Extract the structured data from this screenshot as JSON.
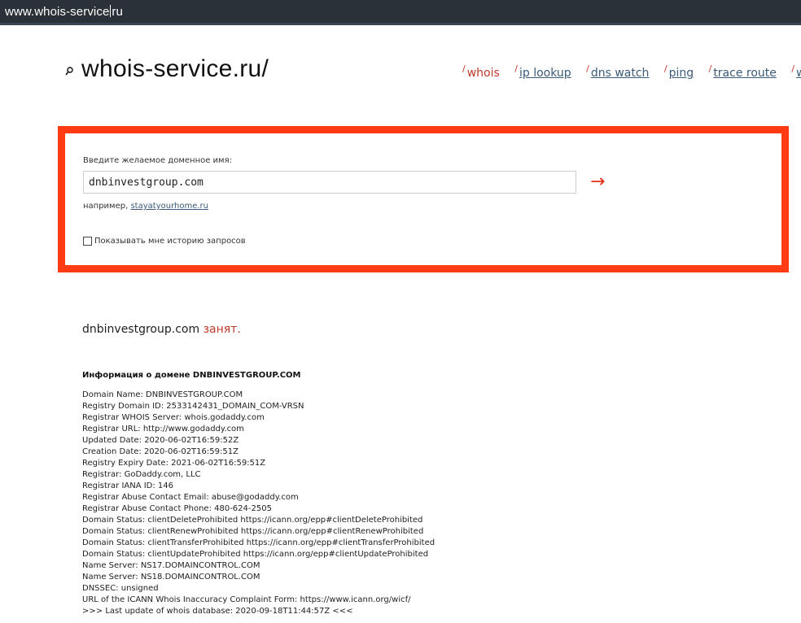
{
  "browser": {
    "url_before_caret": "www.whois-service",
    "url_after_caret": "ru"
  },
  "header": {
    "logo_text": "whois-service.ru/",
    "nav": [
      {
        "label": "whois",
        "active": true
      },
      {
        "label": "ip lookup",
        "active": false
      },
      {
        "label": "dns watch",
        "active": false
      },
      {
        "label": "ping",
        "active": false
      },
      {
        "label": "trace route",
        "active": false
      },
      {
        "label": "wh",
        "active": false
      }
    ]
  },
  "search": {
    "label": "Введите желаемое доменное имя:",
    "value": "dnbinvestgroup.com",
    "go_arrow": "→",
    "example_prefix": "например,",
    "example_link": "stayatyourhome.ru",
    "history_label": "Показывать мне историю запросов",
    "history_checked": false
  },
  "result": {
    "domain": "dnbinvestgroup.com",
    "status": "занят."
  },
  "info": {
    "title": "Информация о домене DNBINVESTGROUP.COM",
    "lines": [
      "Domain Name: DNBINVESTGROUP.COM",
      "Registry Domain ID: 2533142431_DOMAIN_COM-VRSN",
      "Registrar WHOIS Server: whois.godaddy.com",
      "Registrar URL: http://www.godaddy.com",
      "Updated Date: 2020-06-02T16:59:52Z",
      "Creation Date: 2020-06-02T16:59:51Z",
      "Registry Expiry Date: 2021-06-02T16:59:51Z",
      "Registrar: GoDaddy.com, LLC",
      "Registrar IANA ID: 146",
      "Registrar Abuse Contact Email: abuse@godaddy.com",
      "Registrar Abuse Contact Phone: 480-624-2505",
      "Domain Status: clientDeleteProhibited https://icann.org/epp#clientDeleteProhibited",
      "Domain Status: clientRenewProhibited https://icann.org/epp#clientRenewProhibited",
      "Domain Status: clientTransferProhibited https://icann.org/epp#clientTransferProhibited",
      "Domain Status: clientUpdateProhibited https://icann.org/epp#clientUpdateProhibited",
      "Name Server: NS17.DOMAINCONTROL.COM",
      "Name Server: NS18.DOMAINCONTROL.COM",
      "DNSSEC: unsigned",
      "URL of the ICANN Whois Inaccuracy Complaint Form: https://www.icann.org/wicf/",
      ">>> Last update of whois database: 2020-09-18T11:44:57Z <<<"
    ]
  },
  "colors": {
    "accent_red": "#ff3b14",
    "status_red": "#c0392b",
    "link_blue": "#3a5a78",
    "addressbar_bg": "#2b3138"
  }
}
